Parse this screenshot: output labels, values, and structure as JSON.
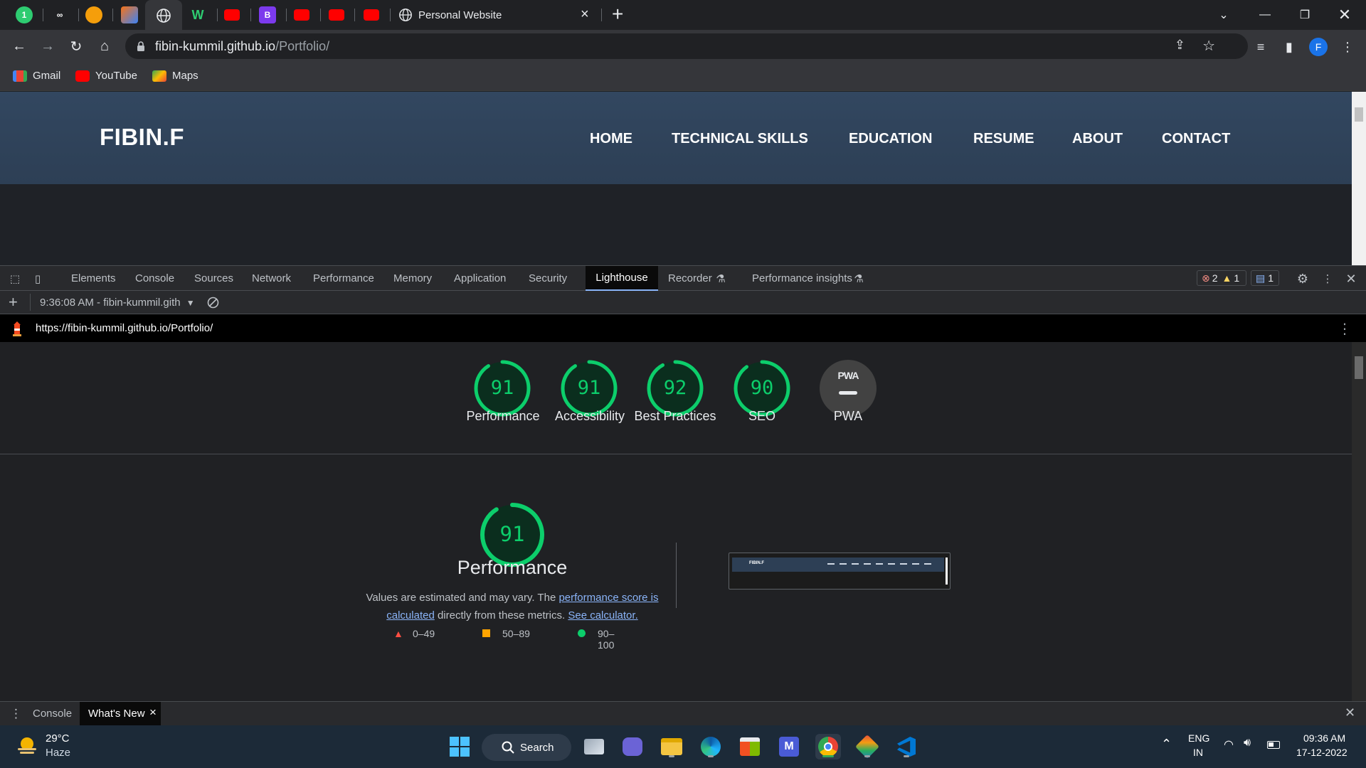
{
  "browser": {
    "active_tab_title": "Personal Website",
    "url_host": "fibin-kummil.github.io",
    "url_path": "/Portfolio/",
    "profile_initial": "F",
    "bookmarks": [
      {
        "label": "Gmail"
      },
      {
        "label": "YouTube"
      },
      {
        "label": "Maps"
      }
    ]
  },
  "site": {
    "logo": "FIBIN.F",
    "nav": [
      "HOME",
      "TECHNICAL SKILLS",
      "EDUCATION",
      "RESUME",
      "ABOUT",
      "CONTACT"
    ]
  },
  "devtools": {
    "tabs": [
      "Elements",
      "Console",
      "Sources",
      "Network",
      "Performance",
      "Memory",
      "Application",
      "Security",
      "Lighthouse",
      "Recorder",
      "Performance insights"
    ],
    "errors": "2",
    "warnings": "1",
    "messages": "1",
    "report_selector": "9:36:08 AM - fibin-kummil.gith",
    "report_url": "https://fibin-kummil.github.io/Portfolio/",
    "drawer_tabs": [
      "Console",
      "What's New"
    ]
  },
  "lighthouse": {
    "scores": [
      {
        "label": "Performance",
        "value": 91
      },
      {
        "label": "Accessibility",
        "value": 91
      },
      {
        "label": "Best Practices",
        "value": 92
      },
      {
        "label": "SEO",
        "value": 90
      },
      {
        "label": "PWA",
        "value": ""
      }
    ],
    "pwa_badge": "PWA",
    "perf_title": "Performance",
    "perf_score": 91,
    "desc_1": "Values are estimated and may vary. The ",
    "desc_link_1": "performance score is calculated",
    "desc_2": " directly from these metrics. ",
    "desc_link_2": "See calculator.",
    "legend": [
      "0–49",
      "50–89",
      "90–100"
    ],
    "thumb_logo": "FIBIN.F",
    "colors": {
      "pass": "#0cce6b",
      "pass_bg": "#0b2e1e",
      "average": "#ffa400",
      "fail": "#ff4e42",
      "link": "#8ab4f8"
    }
  },
  "taskbar": {
    "weather_temp": "29°C",
    "weather_desc": "Haze",
    "search_label": "Search",
    "lang_1": "ENG",
    "lang_2": "IN",
    "time": "09:36 AM",
    "date": "17-12-2022"
  }
}
